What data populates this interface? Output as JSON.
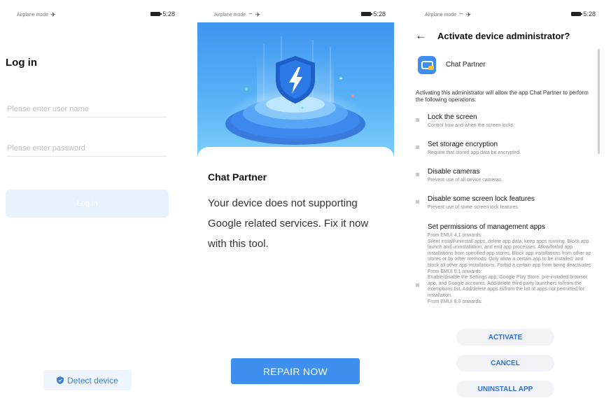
{
  "login_screen": {
    "status": {
      "mode": "Airplane mode",
      "time": "5:28"
    },
    "title": "Log in",
    "username_placeholder": "Please enter user name",
    "password_placeholder": "Please enter password",
    "login_button": "Log in",
    "detect_button": "Detect device",
    "detect_icon": "shield-icon"
  },
  "repair_screen": {
    "status": {
      "mode": "Airplane mode",
      "time": "5:28"
    },
    "hero_icon": "lightning-shield-icon",
    "app_name": "Chat Partner",
    "message": "Your device does not supporting Google related services. Fix it now with this tool.",
    "repair_button": "REPAIR NOW"
  },
  "admin_screen": {
    "status": {
      "mode": "Airplane mode",
      "time": "5:28"
    },
    "title": "Activate device administrator?",
    "app_name": "Chat Partner",
    "intro": "Activating this administrator will allow the app Chat Partner to perform the following operations:",
    "operations": [
      {
        "title": "Lock the screen",
        "desc": "Control how and when the screen locks."
      },
      {
        "title": "Set storage encryption",
        "desc": "Require that stored app data be encrypted."
      },
      {
        "title": "Disable cameras",
        "desc": "Prevent use of all device cameras."
      },
      {
        "title": "Disable some screen lock features",
        "desc": "Prevent use of some screen lock features."
      },
      {
        "title": "Set permissions of management apps",
        "desc": "From EMUI 4.1 onwards:\nSilent install/uninstall apps, delete app data, keep apps running. Block app launch and uninstallation, and end app processes. Allow/forbid app installations from specified app stores. Block app installations from other app stores or by other methods. Only allow a certain app to be installed, and block all other app installations. Forbid a certain app from being deactivated.\nFrom EMUI 5.1 onwards:\nEnable/disable the Settings app, Google Play Store, pre-installed browser app, and Google accounts. Add/delete third-party launchers to/from the exemptions list. Add/delete apps to/from the list of apps not permitted for installation.\nFrom EMUI 8.0 onwards:"
      }
    ],
    "activate_button": "ACTIVATE",
    "cancel_button": "CANCEL",
    "uninstall_button": "UNINSTALL APP"
  }
}
